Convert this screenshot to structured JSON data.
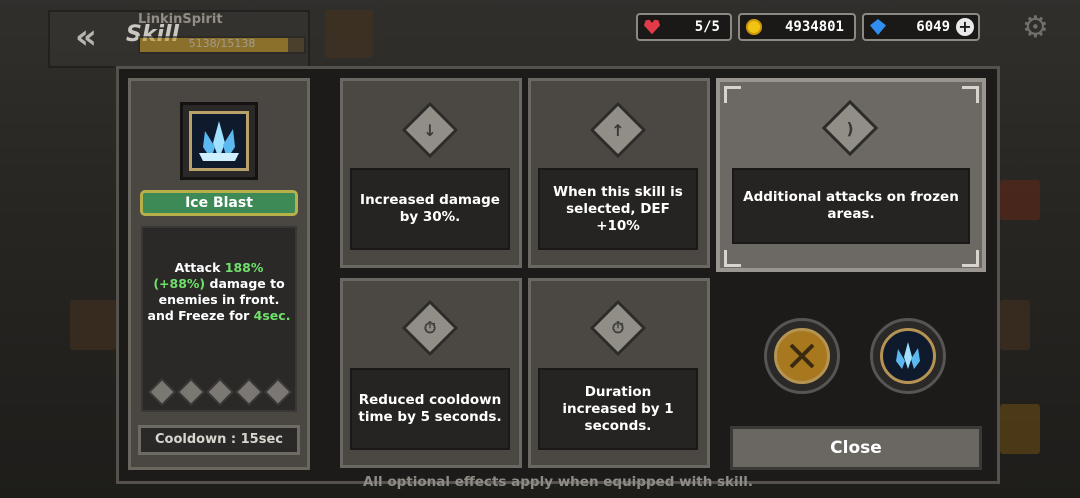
{
  "hud": {
    "back_icon": "double-chevron-left-icon",
    "title": "Skill",
    "username": "LinkinSpirit",
    "xp_text": "5138/15138",
    "energy": "5/5",
    "gold": "4934801",
    "gems": "6049",
    "settings_icon": "gear-icon"
  },
  "skill": {
    "name": "Ice Blast",
    "desc_prefix": "Attack ",
    "desc_pct": "188% (+88%)",
    "desc_mid": " damage to enemies in front. and Freeze for ",
    "desc_duration": "4sec.",
    "cooldown": "Cooldown : 15sec",
    "icon": "ice-crystal-icon"
  },
  "options": [
    {
      "text": "Increased damage by 30%.",
      "icon": "sword-icon",
      "selected": false
    },
    {
      "text": "When this skill is selected, DEF +10%",
      "icon": "sword-up-icon",
      "selected": false
    },
    {
      "text": "Additional attacks on frozen areas.",
      "icon": "sword-wave-icon",
      "selected": true
    },
    {
      "text": "Reduced cooldown time by 5 seconds.",
      "icon": "stopwatch-minus-icon",
      "selected": false
    },
    {
      "text": "Duration increased by 1 seconds.",
      "icon": "stopwatch-icon",
      "selected": false
    }
  ],
  "equip_buttons": [
    "crossed-swords-icon",
    "ice-crystal-icon"
  ],
  "close_label": "Close",
  "footer": "All optional effects apply when equipped with skill.",
  "colors": {
    "highlight": "#6fe06a",
    "name_bar": "#3d8a56"
  }
}
